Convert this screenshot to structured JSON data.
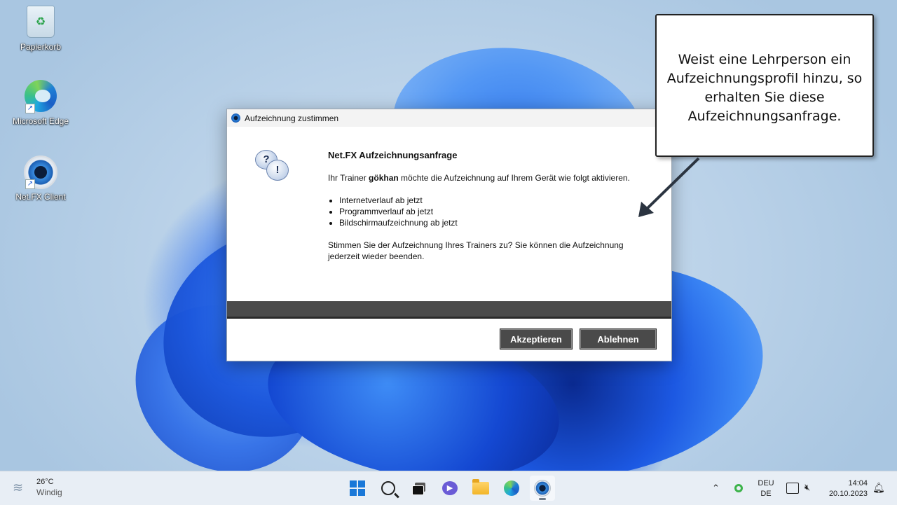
{
  "desktop": {
    "icons": [
      {
        "label": "Papierkorb"
      },
      {
        "label": "Microsoft Edge"
      },
      {
        "label": "Net.FX Client"
      }
    ]
  },
  "dialog": {
    "title": "Aufzeichnung zustimmen",
    "heading": "Net.FX Aufzeichnungsanfrage",
    "intro_prefix": "Ihr Trainer ",
    "trainer_name": "gökhan",
    "intro_suffix": " möchte die Aufzeichnung auf Ihrem Gerät wie folgt aktivieren.",
    "items": [
      "Internetverlauf ab jetzt",
      "Programmverlauf ab jetzt",
      "Bildschirmaufzeichnung ab jetzt"
    ],
    "question": "Stimmen Sie der Aufzeichnung Ihres Trainers zu? Sie können die Aufzeichnung jederzeit wieder beenden.",
    "accept_label": "Akzeptieren",
    "decline_label": "Ablehnen"
  },
  "callout": {
    "text": "Weist eine Lehrperson ein Aufzeichnungsprofil hinzu, so erhalten Sie diese Aufzeichnungsanfrage."
  },
  "taskbar": {
    "weather_temp": "26°C",
    "weather_condition": "Windig",
    "lang_top": "DEU",
    "lang_bottom": "DE",
    "time": "14:04",
    "date": "20.10.2023"
  },
  "colors": {
    "button_bg": "#4a4a4a",
    "dialog_dark_bar": "#4b4b4b",
    "windows_blue": "#1a78d8"
  }
}
